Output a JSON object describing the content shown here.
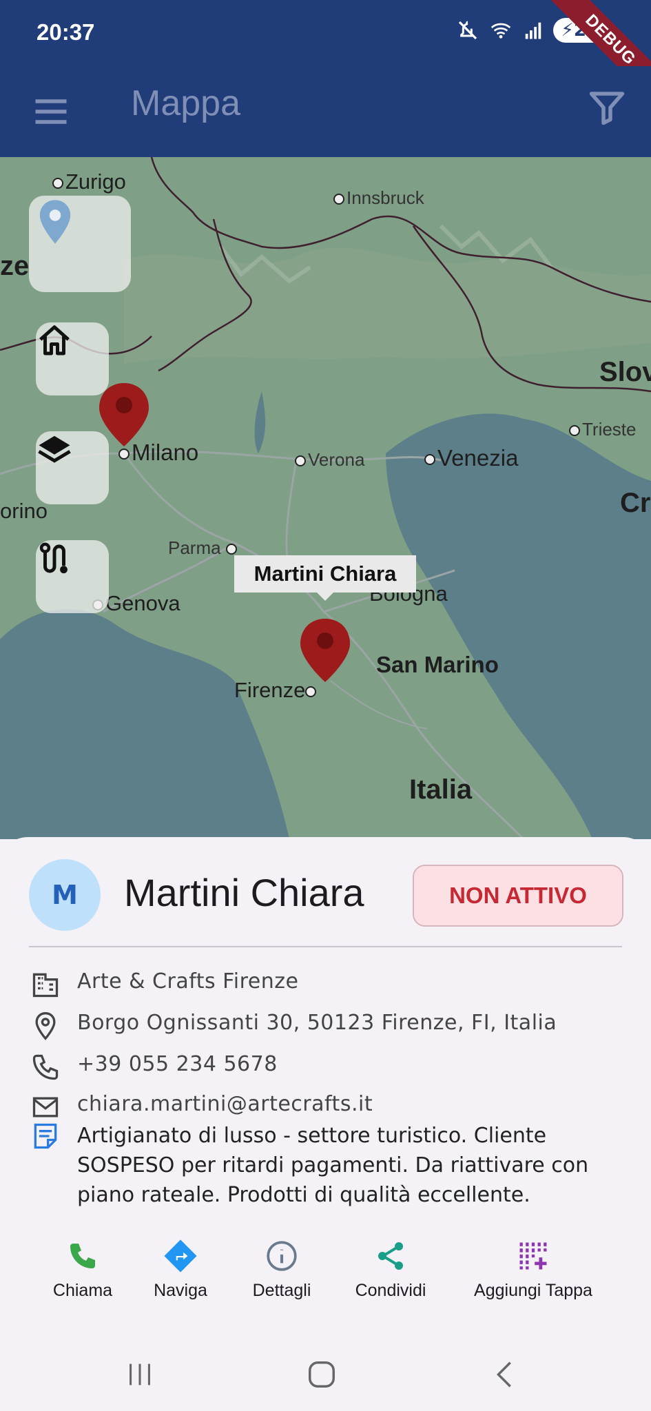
{
  "status_bar": {
    "time": "20:37",
    "battery": "26",
    "debug": "DEBUG"
  },
  "app_bar": {
    "title": "Mappa",
    "menu_icon": "hamburger-menu-icon",
    "filter_icon": "filter-funnel-icon"
  },
  "map": {
    "cities": [
      "Zurigo",
      "Innsbruck",
      "Milano",
      "Verona",
      "Venezia",
      "Trieste",
      "Parma",
      "Bologna",
      "Genova",
      "Firenze",
      "San Marino",
      "Italia",
      "Slov",
      "Cr",
      "ze",
      "orino"
    ],
    "tooltip": "Martini Chiara",
    "colors": {
      "pin": "#9e1b1b",
      "water": "#5c7f8a",
      "land": "#7f9f86"
    }
  },
  "map_controls": {
    "locate_icon": "location-pin-icon",
    "home_icon": "home-icon",
    "layers_icon": "layers-icon",
    "route_icon": "route-icon"
  },
  "contact": {
    "initial": "M",
    "name": "Martini Chiara",
    "status": "NON ATTIVO",
    "company": "Arte & Crafts Firenze",
    "address": "Borgo Ognissanti 30, 50123 Firenze, FI, Italia",
    "phone": "+39 055 234 5678",
    "email": "chiara.martini@artecrafts.it",
    "notes": "Artigianato di lusso - settore turistico. Cliente SOSPESO per ritardi pagamenti. Da riattivare con piano rateale. Prodotti di qualità eccellente."
  },
  "actions": {
    "call": "Chiama",
    "navigate": "Naviga",
    "details": "Dettagli",
    "share": "Condividi",
    "add_stop": "Aggiungi Tappa"
  },
  "action_colors": {
    "call": "#3aa84a",
    "navigate": "#2196f3",
    "details": "#6a7a8e",
    "share": "#1a9e8a",
    "add_stop": "#8e35b0"
  }
}
